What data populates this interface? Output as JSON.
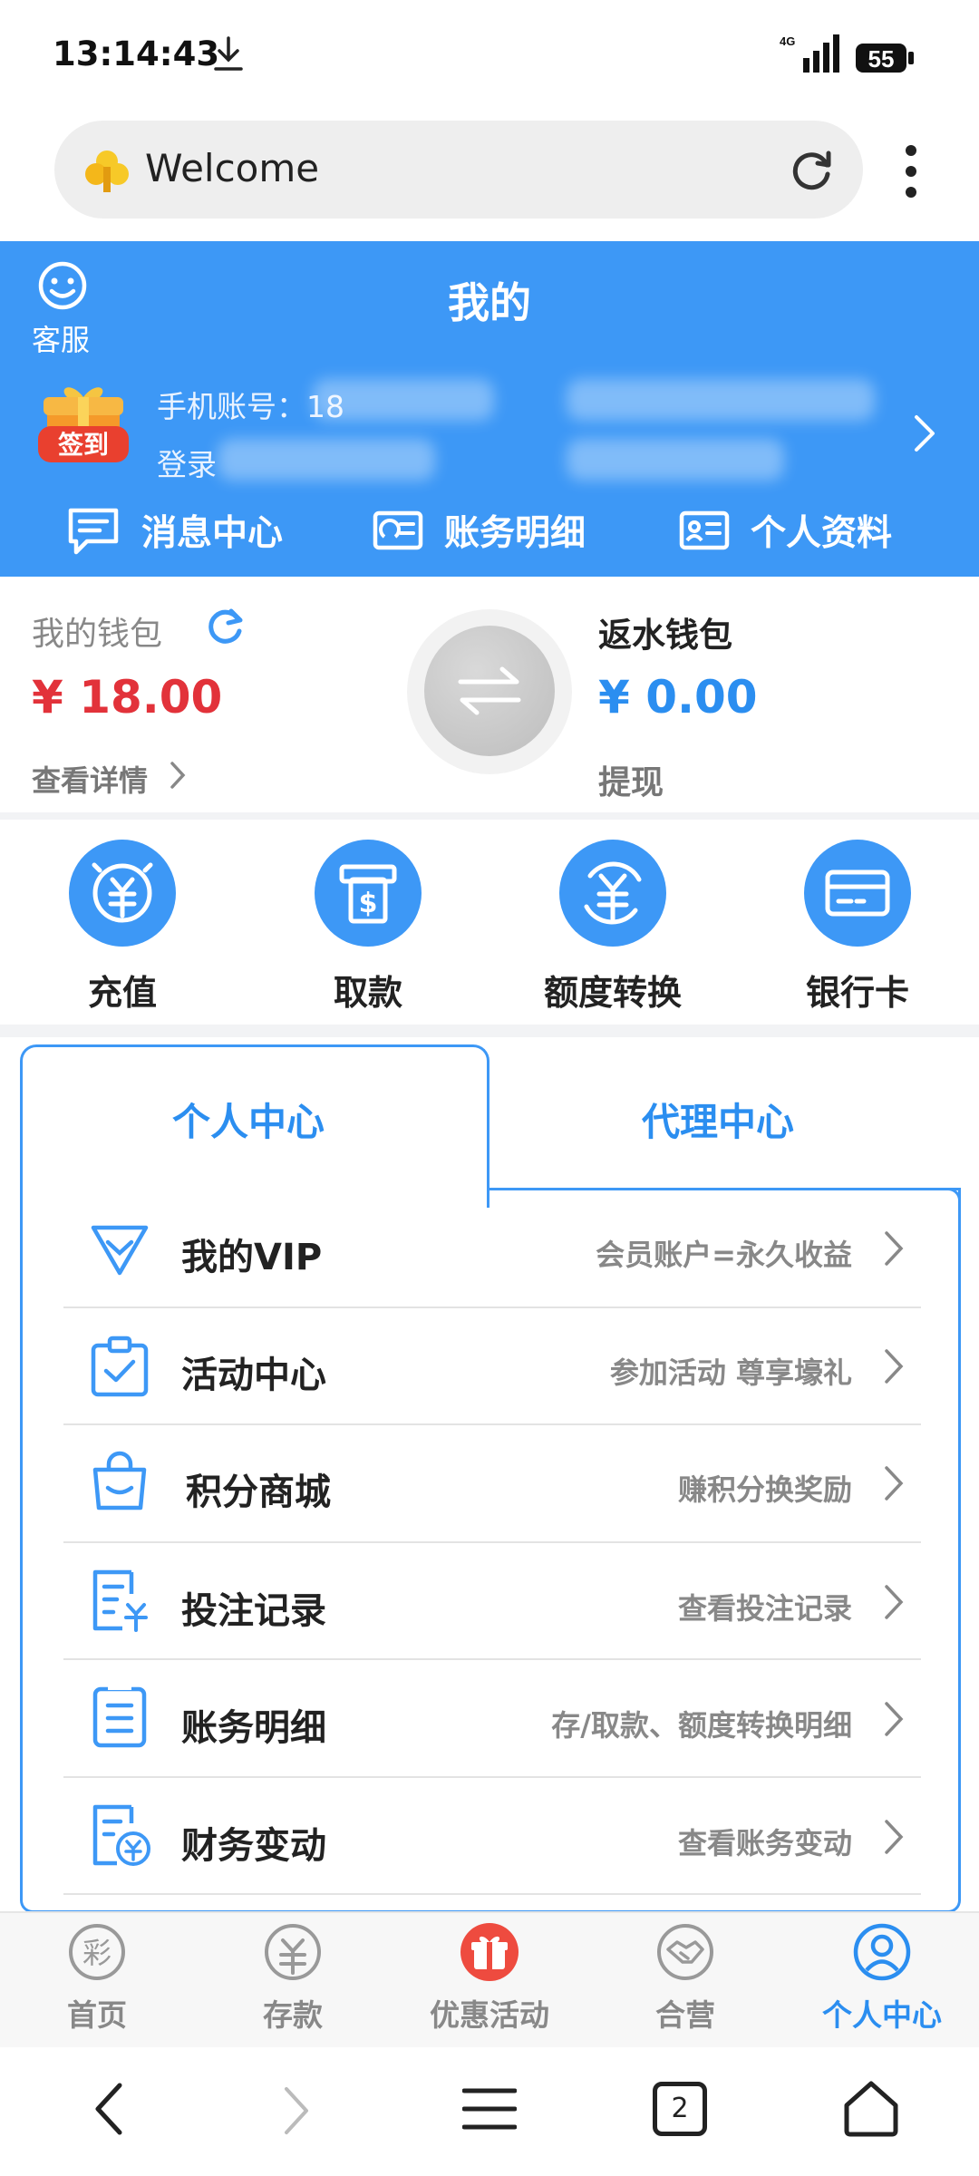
{
  "status_bar": {
    "time": "13:14:43",
    "network": "4G",
    "battery": "55"
  },
  "browser": {
    "url_text": "Welcome"
  },
  "header": {
    "customer_service": "客服",
    "title": "我的",
    "signin_badge": "签到",
    "account_label": "手机账号：18",
    "login_label": "登录",
    "links": [
      "消息中心",
      "账务明细",
      "个人资料"
    ]
  },
  "wallet": {
    "title": "我的钱包",
    "amount": "¥ 18.00",
    "detail": "查看详情",
    "rebate_title": "返水钱包",
    "rebate_amount": "¥ 0.00",
    "withdraw": "提现"
  },
  "quick_actions": [
    "充值",
    "取款",
    "额度转换",
    "银行卡"
  ],
  "tabs": {
    "personal": "个人中心",
    "agent": "代理中心"
  },
  "menu": [
    {
      "title": "我的VIP",
      "sub": "会员账户=永久收益",
      "icon": "diamond-icon"
    },
    {
      "title": "活动中心",
      "sub": "参加活动 尊享壕礼",
      "icon": "clipboard-check-icon"
    },
    {
      "title": "积分商城",
      "sub": "赚积分换奖励",
      "icon": "shopping-bag-icon"
    },
    {
      "title": "投注记录",
      "sub": "查看投注记录",
      "icon": "bet-record-icon"
    },
    {
      "title": "账务明细",
      "sub": "存/取款、额度转换明细",
      "icon": "list-icon"
    },
    {
      "title": "财务变动",
      "sub": "查看账务变动",
      "icon": "finance-icon"
    }
  ],
  "bottom_nav": [
    "首页",
    "存款",
    "优惠活动",
    "合营",
    "个人中心"
  ],
  "system_nav": {
    "tab_count": "2"
  },
  "colors": {
    "primary": "#3d98f6",
    "accent_red": "#e2323a",
    "promo_red": "#ee4b3f"
  }
}
